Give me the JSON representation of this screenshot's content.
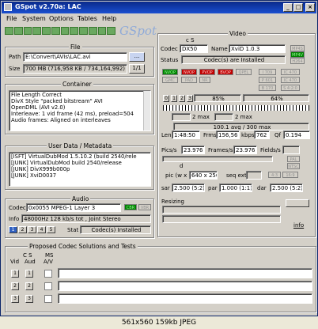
{
  "window": {
    "title": "GSpot v2.70a: LAC"
  },
  "menu": [
    "File",
    "System",
    "Options",
    "Tables",
    "Help"
  ],
  "logo": "GSpot",
  "file": {
    "title": "File",
    "path_label": "Path",
    "path": "E:\\Convert\\AVIs\\LAC.avi",
    "browse": "...",
    "size_label": "Size",
    "size": "700 MB (716,958 KB / 734,164,992)",
    "page": "1/1"
  },
  "container": {
    "title": "Container",
    "lines": [
      "File Length Correct",
      "DivX Style \"packed bitstream\" AVI",
      "OpenDML (AVI v2.0)",
      "Interleave: 1 vid frame (42 ms), preload=504",
      "Audio frames: Aligned on interleaves"
    ]
  },
  "userdata": {
    "title": "User Data / Metadata",
    "lines": [
      "[ISFT]   VirtualDubMod 1.5.10.2 (build 2540/rele",
      "[JUNK]   VirtualDubMod build 2540/release",
      "[JUNK]   DivX999b000p",
      "[JUNK]   XviD0037"
    ]
  },
  "audio": {
    "title": "Audio",
    "codec_label": "Codec",
    "codec": "0x0055 MPEG-1 Layer 3",
    "cbr": "CBR",
    "vbr": "VBR",
    "info_label": "Info",
    "info": "48000Hz  128 kb/s tot , Joint Stereo",
    "stat_label": "Stat",
    "stat": "Codec(s) Installed",
    "tabs": [
      "1",
      "2",
      "3",
      "4",
      "5"
    ]
  },
  "proposed": {
    "title": "Proposed Codec Solutions and Tests",
    "vid": "Vid",
    "aud": "Aud",
    "ms": "MS",
    "av": "A/V",
    "rows": [
      "1",
      "2",
      "3"
    ]
  },
  "video": {
    "title": "Video",
    "cs": "c S",
    "codec_label": "Codec",
    "codec": "DX50",
    "name_label": "Name",
    "name": "XviD 1.0.3",
    "status_label": "Status",
    "status": "Codec(s) are Installed",
    "mp4s": "MP4S",
    "mp4v": "MP4V",
    "h264": "H264",
    "flags_row1": [
      "NVOP",
      "PVOP",
      "BVOP",
      "QPEL",
      "GMC"
    ],
    "flags_right": [
      "I 709",
      "P 601",
      "B 170",
      "IC 470",
      "IC 470",
      "S 4:2:0"
    ],
    "flag_a": "NVOP",
    "pad": "PAD",
    "nr": "NR",
    "ctrl": [
      "0",
      "1",
      "2",
      "3"
    ],
    "pct1": "85%",
    "pct2": "64%",
    "max1": "2 max",
    "max2": "2 max",
    "bitrate": "100.1 avg / 300 max",
    "len_label": "Len",
    "len": "1:48:50",
    "frms_label": "Frms",
    "frms": "156,56",
    "kbps_label": "kbps",
    "kbps": "762",
    "qf_label": "Qf",
    "qf": "0.194",
    "pics_label": "Pics/s",
    "pics": "23.976",
    "frames_label": "Frames/s",
    "frames": "23.976",
    "fields_label": "Fields/s",
    "ntsc": "NTSC",
    "pal": "PAL",
    "d": "d",
    "pic_label": "pic (w x h)",
    "pic": "640 x 256",
    "seq_label": "seq ext",
    "sar_label": "sar",
    "sar": "2.500 (5:2)",
    "par_label": "par",
    "par": "1.000 (1:1)",
    "dar_label": "dar",
    "dar": "2.500 (5:2)",
    "resizing_label": "Resizing",
    "info": "info"
  },
  "caption": "561x560  159kb  JPEG"
}
